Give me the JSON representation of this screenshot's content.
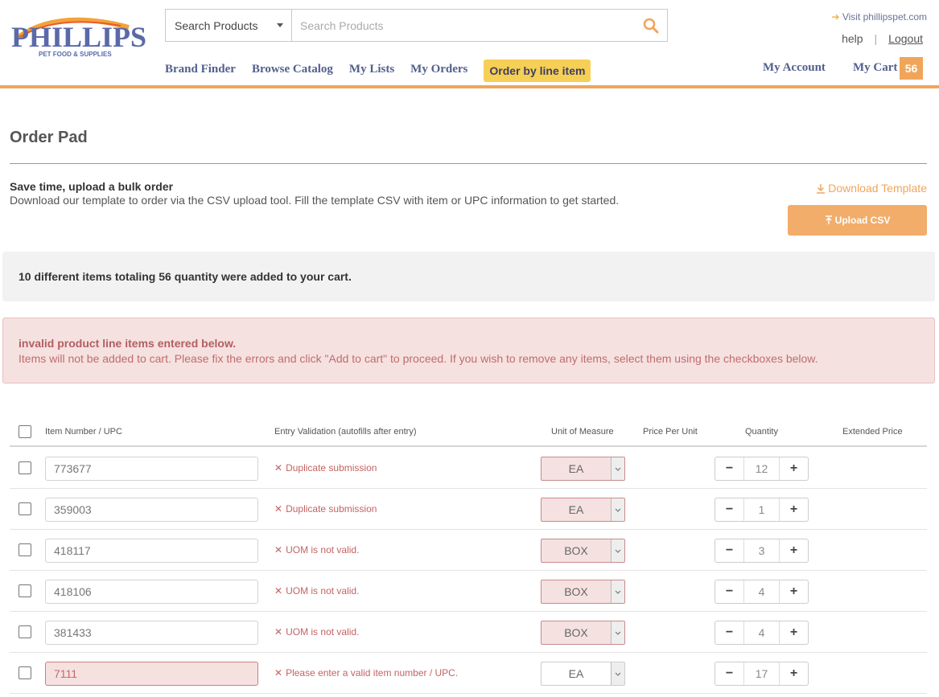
{
  "brand": {
    "name": "PHILLIPS",
    "tagline": "PET FOOD & SUPPLIES"
  },
  "search": {
    "category_value": "Search Products",
    "placeholder": "Search Products"
  },
  "nav": {
    "items": [
      {
        "label": "Brand Finder"
      },
      {
        "label": "Browse Catalog"
      },
      {
        "label": "My Lists"
      },
      {
        "label": "My Orders"
      },
      {
        "label": "Order by line item"
      }
    ],
    "account_label": "My Account",
    "cart_label": "My Cart",
    "cart_count": "56"
  },
  "top_links": {
    "visit": "Visit phillipspet.com",
    "help": "help",
    "separator": "|",
    "logout": "Logout"
  },
  "page": {
    "title": "Order Pad",
    "bulk_heading": "Save time, upload a bulk order",
    "bulk_desc": "Download our template to order via the CSV upload tool. Fill the template CSV with item or UPC information to get started.",
    "download_label": "Download Template",
    "upload_label": "Upload CSV"
  },
  "messages": {
    "success": "10 different items totaling 56 quantity were added to your cart.",
    "error_title": "invalid product line items entered below.",
    "error_desc": "Items will not be added to cart. Please fix the errors and click \"Add to cart\" to proceed. If you wish to remove any items, select them using the checkboxes below."
  },
  "table": {
    "headers": {
      "item": "Item Number / UPC",
      "validation": "Entry Validation (autofills after entry)",
      "uom": "Unit of Measure",
      "price": "Price Per Unit",
      "qty": "Quantity",
      "extended": "Extended Price"
    },
    "rows": [
      {
        "item": "773677",
        "validation": "Duplicate submission",
        "uom": "EA",
        "qty": "12"
      },
      {
        "item": "359003",
        "validation": "Duplicate submission",
        "uom": "EA",
        "qty": "1"
      },
      {
        "item": "418117",
        "validation": "UOM is not valid.",
        "uom": "BOX",
        "qty": "3"
      },
      {
        "item": "418106",
        "validation": "UOM is not valid.",
        "uom": "BOX",
        "qty": "4"
      },
      {
        "item": "381433",
        "validation": "UOM is not valid.",
        "uom": "BOX",
        "qty": "4"
      },
      {
        "item": "7111",
        "validation": "Please enter a valid item number / UPC.",
        "uom": "EA",
        "qty": "17"
      }
    ]
  },
  "colors": {
    "accent": "#f0a55a",
    "nav_text": "#52608e",
    "error": "#c46363",
    "active_tab": "#f6cf55"
  }
}
